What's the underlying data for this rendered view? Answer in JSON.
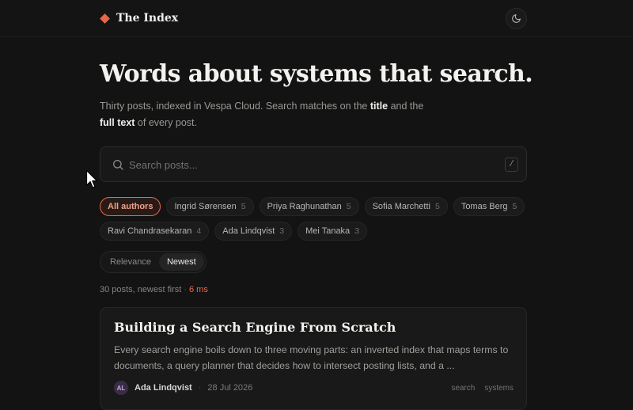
{
  "brand": {
    "name": "The Index"
  },
  "hero": {
    "title": "Words about systems that search.",
    "sub_part1": "Thirty posts, indexed in Vespa Cloud. Search matches on the ",
    "sub_bold1": "title",
    "sub_part2": " and the ",
    "sub_bold2": "full text",
    "sub_part3": " of every post."
  },
  "search": {
    "placeholder": "Search posts...",
    "value": "",
    "shortcut": "/"
  },
  "authors": [
    {
      "name": "All authors",
      "count": "",
      "active": true
    },
    {
      "name": "Ingrid Sørensen",
      "count": "5"
    },
    {
      "name": "Priya Raghunathan",
      "count": "5"
    },
    {
      "name": "Sofia Marchetti",
      "count": "5"
    },
    {
      "name": "Tomas Berg",
      "count": "5"
    },
    {
      "name": "Ravi Chandrasekaran",
      "count": "4"
    },
    {
      "name": "Ada Lindqvist",
      "count": "3"
    },
    {
      "name": "Mei Tanaka",
      "count": "3"
    }
  ],
  "sort": {
    "options": [
      "Relevance",
      "Newest"
    ],
    "selected": "Newest"
  },
  "results": {
    "summary": "30 posts, newest first",
    "separator": "·",
    "timing": "6 ms"
  },
  "posts": [
    {
      "title": "Building a Search Engine From Scratch",
      "excerpt": "Every search engine boils down to three moving parts: an inverted index that maps terms to documents, a query planner that decides how to intersect posting lists, and a ...",
      "author_initials": "AL",
      "author": "Ada Lindqvist",
      "date": "28 Jul 2026",
      "tags": [
        "search",
        "systems"
      ]
    }
  ],
  "icons": {
    "brand": "diamond-icon",
    "theme": "moon-icon",
    "search": "search-icon",
    "cursor": "cursor-icon"
  },
  "colors": {
    "accent": "#e8674a",
    "background": "#131313"
  }
}
